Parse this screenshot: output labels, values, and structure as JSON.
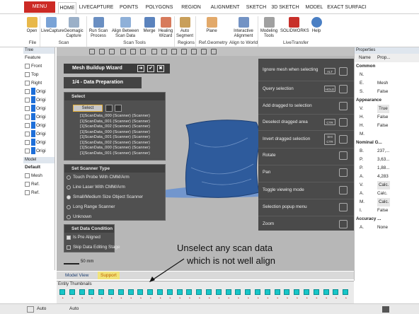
{
  "ribbon_tabs": [
    "MENU",
    "HOME",
    "LIVECAPTURE",
    "POINTS",
    "POLYGONS",
    "REGION",
    "ALIGNMENT",
    "SKETCH",
    "3D SKETCH",
    "MODEL",
    "EXACT SURFACI"
  ],
  "ribbon_buttons": [
    "Open",
    "LiveCapture",
    "Geomagic Capture",
    "Run Scan Process",
    "Align Between Scan Data",
    "Merge",
    "Healing Wizard",
    "Auto Segment",
    "Plane",
    "Interactive Alignment",
    "Modeling Tools",
    "SOLIDWORKS",
    "Help"
  ],
  "ribbon_groups": [
    "File",
    "Scan",
    "Scan Tools",
    "Regions",
    "Ref.Geometry",
    "Align to World",
    "LiveTransfer"
  ],
  "tree": {
    "header": "Tree",
    "feature": "Feature",
    "items": [
      "Front",
      "Top",
      "Right",
      "Origi",
      "Origi",
      "Origi",
      "Origi",
      "Origi",
      "Origi",
      "Origi",
      "Origi"
    ],
    "model": "Model",
    "model_items": [
      "Default",
      "Mesh",
      "Ref.",
      "Ref."
    ]
  },
  "wizard": {
    "title": "Mesh Buildup Wizard",
    "step": "1/4 - Data Preparation",
    "select_section": "Select",
    "select_value": "Select",
    "scans": [
      "[1]ScanData_000 (Scanner) (Scanner)",
      "[1]ScanData_001 (Scanner) (Scanner)",
      "[1]ScanData_002 (Scanner) (Scanner)",
      "[1]ScanData_000 (Scanner) (Scanner)",
      "[1]ScanData_001 (Scanner) (Scanner)",
      "[1]ScanData_002 (Scanner) (Scanner)",
      "[1]ScanData_000 (Scanner) (Scanner)",
      "[1]ScanData_001 (Scanner) (Scanner)"
    ],
    "scanner_section": "Set Scanner Type",
    "scanner_options": [
      "Touch Probe With CMM/Arm",
      "Line Laser With CMM/Arm",
      "Small/Medium Size Object Scanner",
      "Long Range Scanner",
      "Unknown"
    ],
    "condition_section": "Set Data Condition",
    "condition_options": [
      "Is Pre Aligned",
      "Skip Data Editing Stage"
    ],
    "scale": "50 mm"
  },
  "selection_menu": [
    {
      "label": "Ignore mesh when selecting",
      "key": "ALT"
    },
    {
      "label": "Query selection",
      "key": "HOLD"
    },
    {
      "label": "Add dragged to selection",
      "key": ""
    },
    {
      "label": "Deselect dragged area",
      "key": "CTR"
    },
    {
      "label": "Invert dragged selection",
      "key": "SHI CTR"
    },
    {
      "label": "Rotate",
      "key": ""
    },
    {
      "label": "Pan",
      "key": ""
    },
    {
      "label": "Toggle viewing mode",
      "key": ""
    },
    {
      "label": "Selection popup menu",
      "key": ""
    },
    {
      "label": "Zoom",
      "key": ""
    }
  ],
  "properties": {
    "header": "Properties",
    "name_col": "Name",
    "prop_col": "Prop...",
    "rows": [
      {
        "k": "Common",
        "v": "",
        "sec": true
      },
      {
        "k": "N.",
        "v": ""
      },
      {
        "k": "E.",
        "v": "Mesh"
      },
      {
        "k": "S.",
        "v": "False"
      },
      {
        "k": "Appearance",
        "v": "",
        "sec": true
      },
      {
        "k": "V.",
        "v": "True",
        "box": true
      },
      {
        "k": "H.",
        "v": "False"
      },
      {
        "k": "H.",
        "v": "False"
      },
      {
        "k": "M.",
        "v": "",
        "box": true
      },
      {
        "k": "Nominal G...",
        "v": "",
        "sec": true
      },
      {
        "k": "B.",
        "v": "237,..."
      },
      {
        "k": "P.",
        "v": "3,63..."
      },
      {
        "k": "P.",
        "v": "1,88..."
      },
      {
        "k": "A.",
        "v": "4,283"
      },
      {
        "k": "V.",
        "v": "Calc.",
        "box": true
      },
      {
        "k": "A.",
        "v": "Calc."
      },
      {
        "k": "M.",
        "v": "Calc.",
        "box": true
      },
      {
        "k": "I.",
        "v": "False"
      },
      {
        "k": "Accuracy ...",
        "v": "",
        "sec": true
      },
      {
        "k": "A.",
        "v": "None"
      }
    ]
  },
  "bottom_tabs": [
    "Model View",
    "Support"
  ],
  "thumbs_label": "Entity Thumbnails",
  "annotation": [
    "Unselect any scan data",
    "which is not well align"
  ],
  "status": {
    "auto1": "Auto",
    "auto2": "Auto"
  },
  "colors": {
    "accent": "#cc2a25",
    "thumb": "#18c6c8",
    "mesh": "#2e5b9c"
  }
}
